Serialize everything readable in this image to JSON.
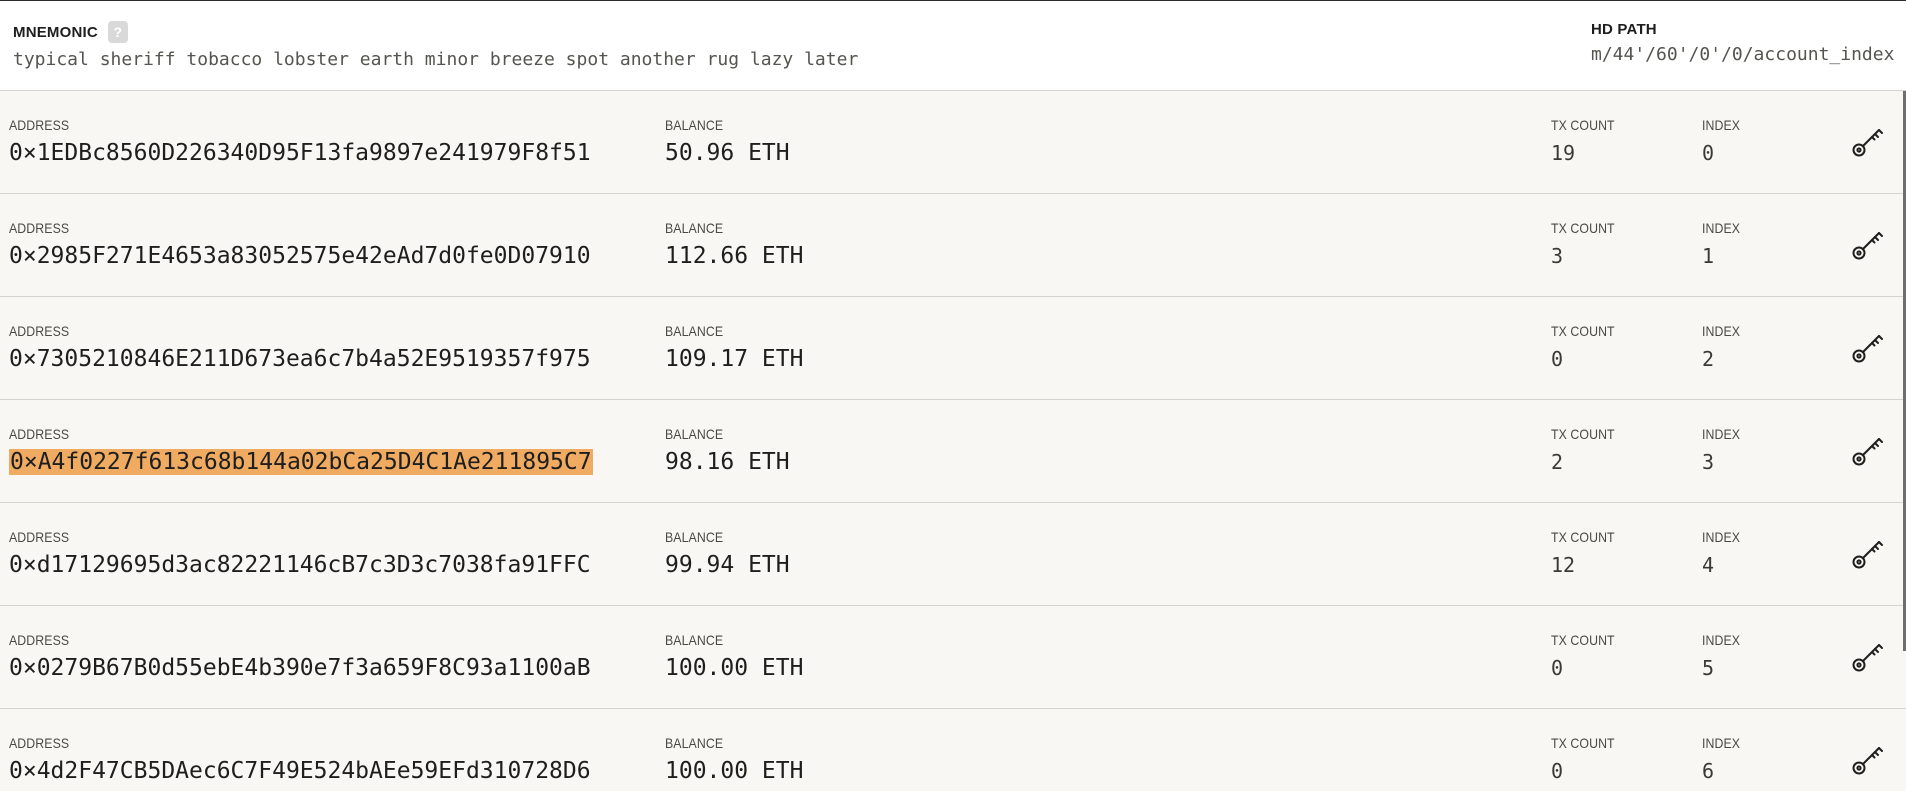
{
  "header": {
    "mnemonic_label": "MNEMONIC",
    "help_symbol": "?",
    "mnemonic_words": "typical sheriff tobacco lobster earth minor breeze spot another rug lazy later",
    "hdpath_label": "HD PATH",
    "hdpath_value": "m/44'/60'/0'/0/account_index"
  },
  "labels": {
    "address": "ADDRESS",
    "balance": "BALANCE",
    "tx_count": "TX COUNT",
    "index": "INDEX"
  },
  "icons": {
    "key": "key-icon",
    "help": "question-icon"
  },
  "colors": {
    "highlight": "#f0ab62"
  },
  "accounts": [
    {
      "address": "0×1EDBc8560D226340D95F13fa9897e241979F8f51",
      "balance": "50.96 ETH",
      "tx_count": "19",
      "index": "0",
      "highlighted": false
    },
    {
      "address": "0×2985F271E4653a83052575e42eAd7d0fe0D07910",
      "balance": "112.66 ETH",
      "tx_count": "3",
      "index": "1",
      "highlighted": false
    },
    {
      "address": "0×7305210846E211D673ea6c7b4a52E9519357f975",
      "balance": "109.17 ETH",
      "tx_count": "0",
      "index": "2",
      "highlighted": false
    },
    {
      "address": "0×A4f0227f613c68b144a02bCa25D4C1Ae211895C7",
      "balance": "98.16 ETH",
      "tx_count": "2",
      "index": "3",
      "highlighted": true
    },
    {
      "address": "0×d17129695d3ac82221146cB7c3D3c7038fa91FFC",
      "balance": "99.94 ETH",
      "tx_count": "12",
      "index": "4",
      "highlighted": false
    },
    {
      "address": "0×0279B67B0d55ebE4b390e7f3a659F8C93a1100aB",
      "balance": "100.00 ETH",
      "tx_count": "0",
      "index": "5",
      "highlighted": false
    },
    {
      "address": "0×4d2F47CB5DAec6C7F49E524bAEe59EFd310728D6",
      "balance": "100.00 ETH",
      "tx_count": "0",
      "index": "6",
      "highlighted": false
    }
  ]
}
